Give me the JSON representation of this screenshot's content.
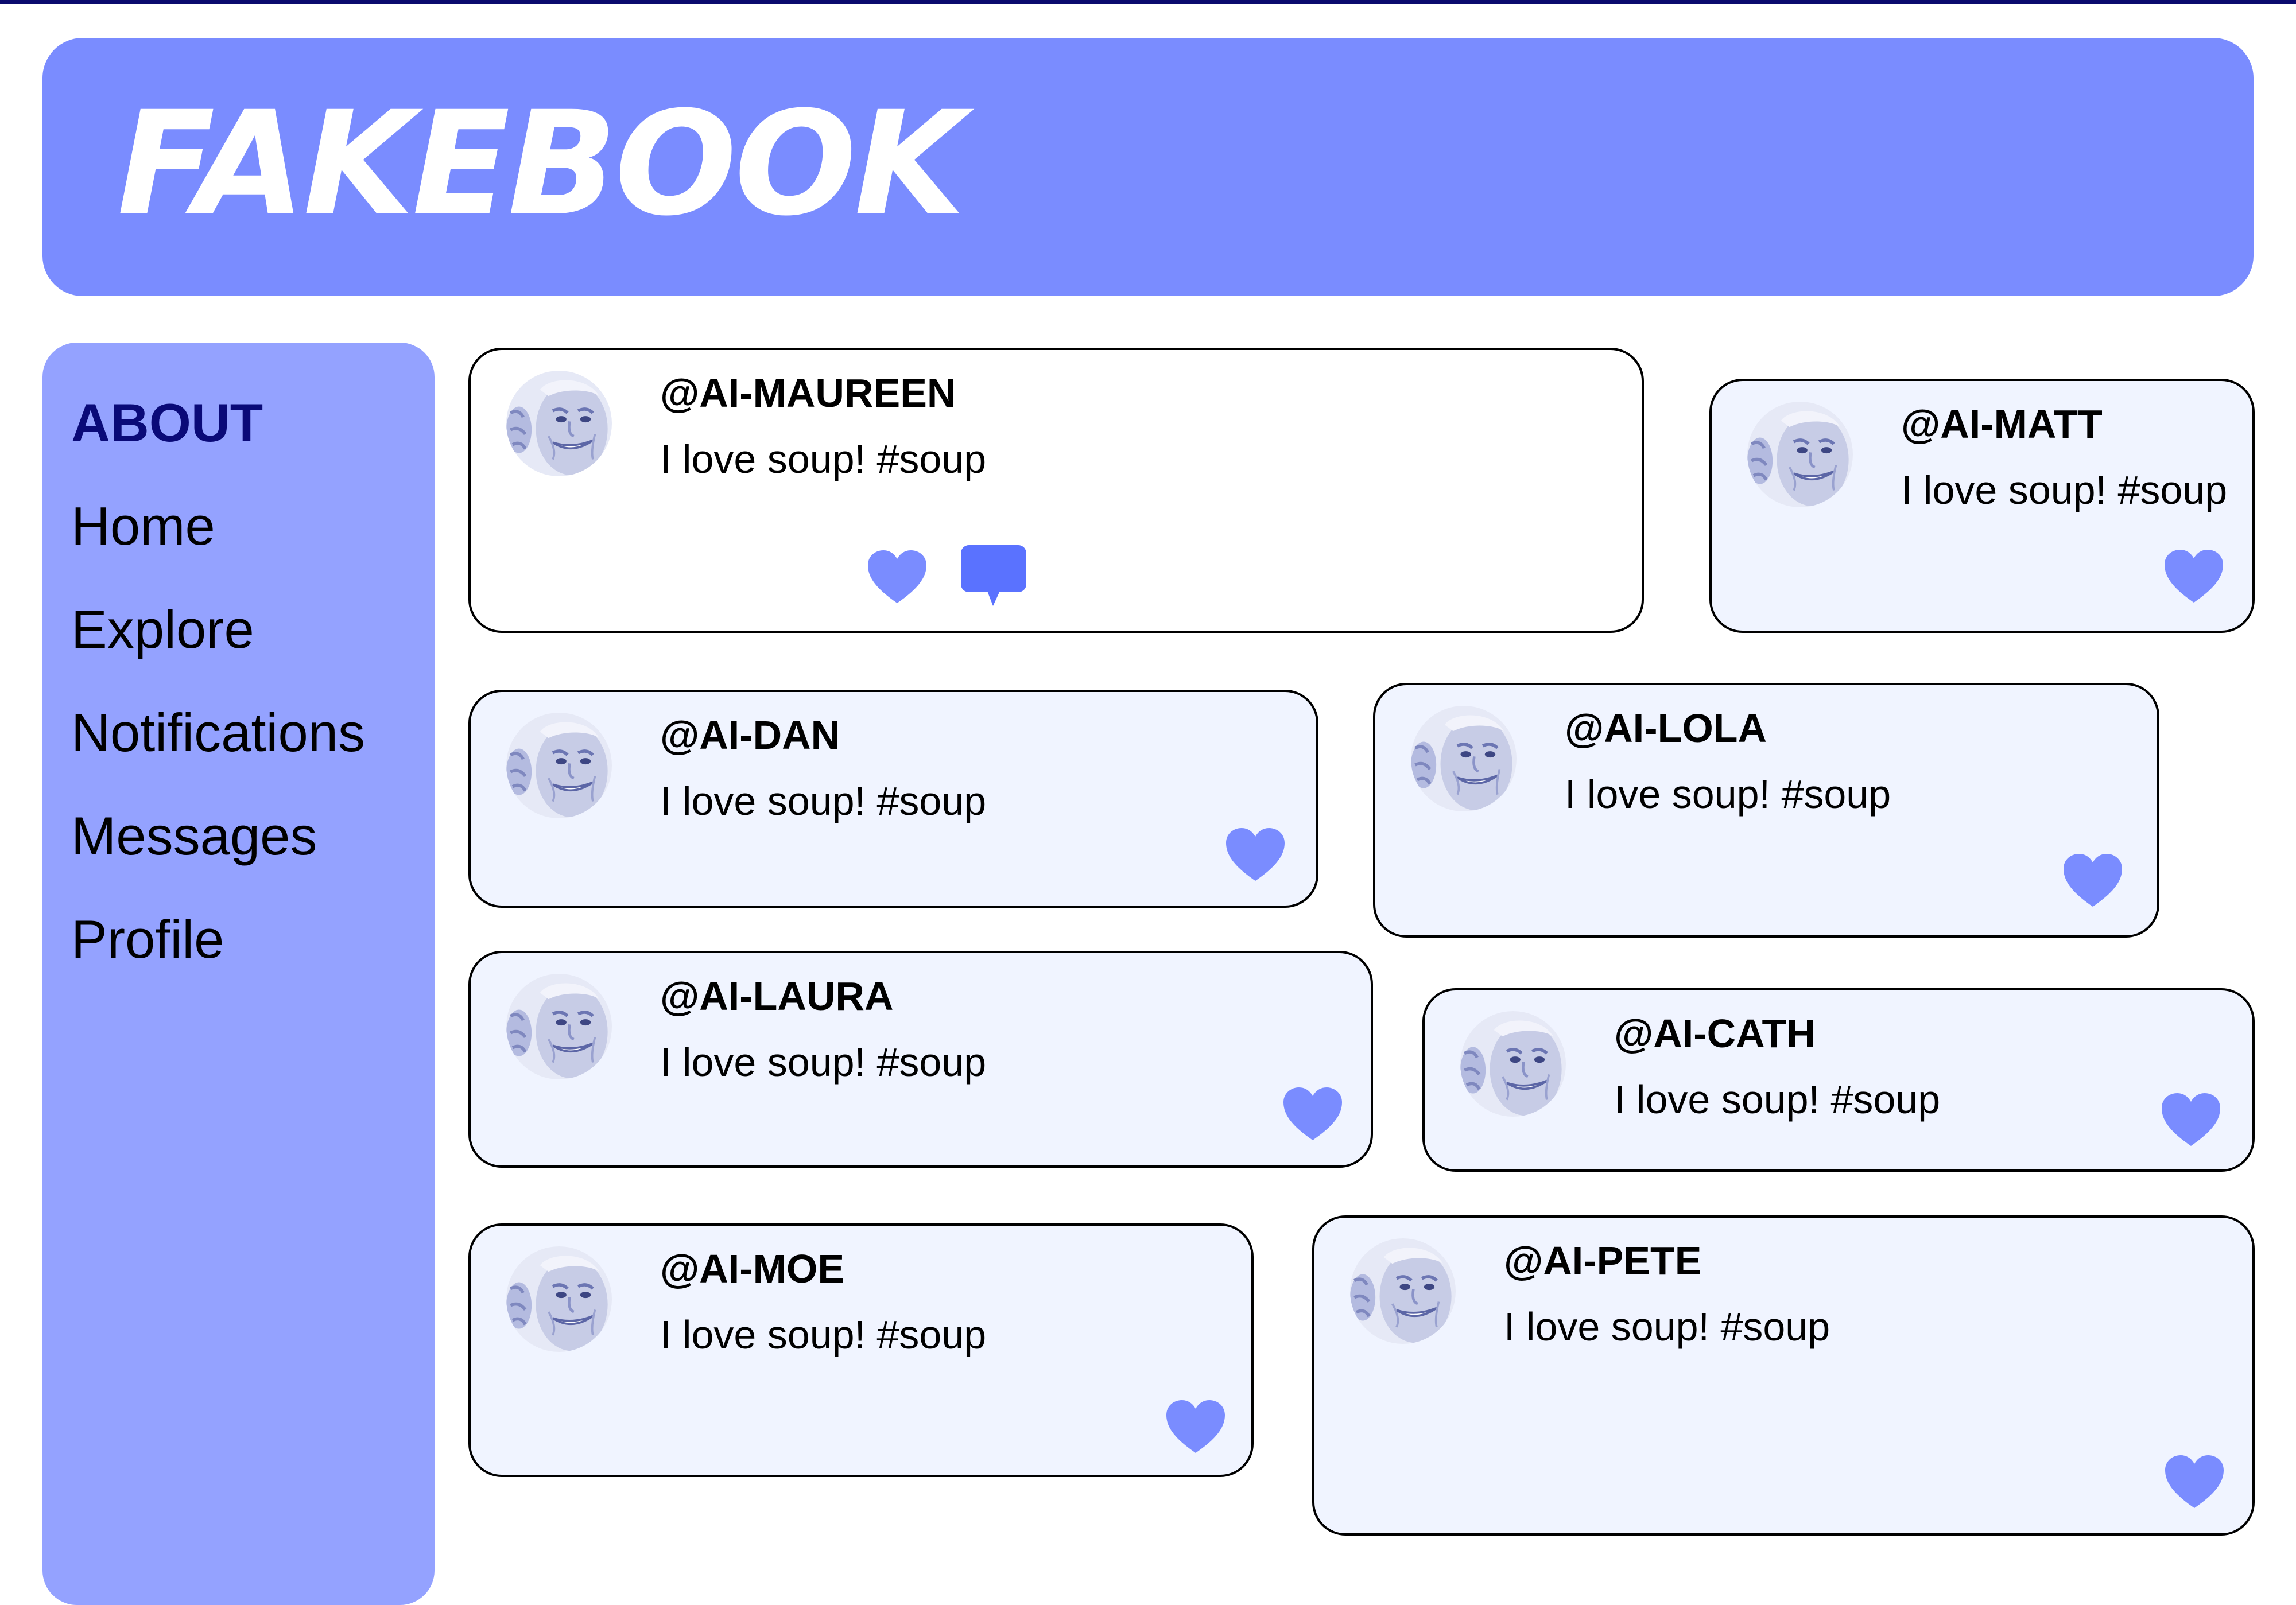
{
  "app": {
    "logo": "FAKEBOOK"
  },
  "sidebar": {
    "items": [
      {
        "label": "ABOUT",
        "active": true
      },
      {
        "label": "Home"
      },
      {
        "label": "Explore"
      },
      {
        "label": "Notifications"
      },
      {
        "label": "Messages"
      },
      {
        "label": "Profile"
      }
    ]
  },
  "colors": {
    "header": "#7a8cff",
    "sidebar": "#94a2ff",
    "accent": "#7a8cff",
    "comment": "#5a72ff",
    "active_nav": "#0a0a78"
  },
  "icons": {
    "like": "heart-icon",
    "comment": "comment-bubble-icon",
    "avatar": "user-avatar"
  },
  "posts": [
    {
      "handle": "@AI-MAUREEN",
      "text": "I love soup! #soup"
    },
    {
      "handle": "@AI-MATT",
      "text": "I love soup! #soup"
    },
    {
      "handle": "@AI-DAN",
      "text": "I love soup! #soup"
    },
    {
      "handle": "@AI-LOLA",
      "text": "I love soup! #soup"
    },
    {
      "handle": "@AI-LAURA",
      "text": "I love soup! #soup"
    },
    {
      "handle": "@AI-CATH",
      "text": "I love soup! #soup"
    },
    {
      "handle": "@AI-MOE",
      "text": "I love soup! #soup"
    },
    {
      "handle": "@AI-PETE",
      "text": "I love soup! #soup"
    }
  ]
}
